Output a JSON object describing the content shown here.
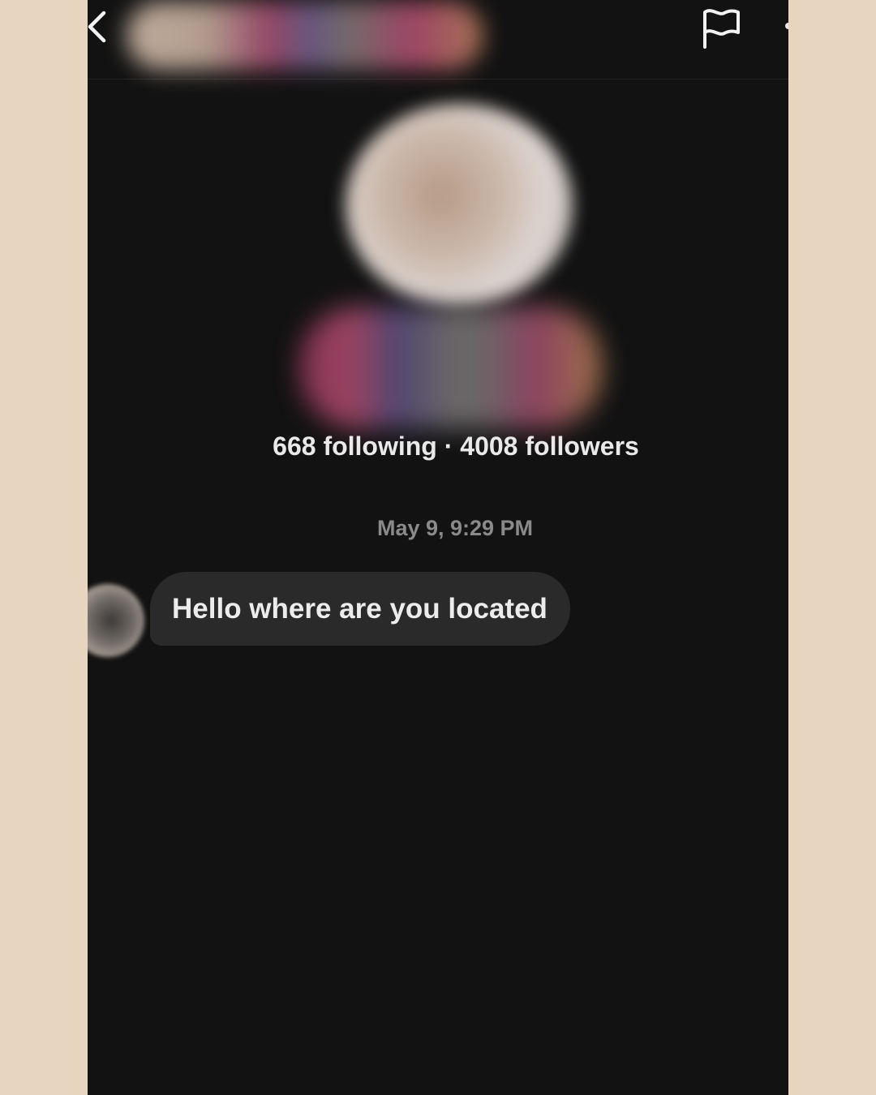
{
  "header": {
    "back_icon": "chevron-left-icon",
    "report_icon": "flag-icon",
    "more_icon": "more-dots-icon"
  },
  "profile": {
    "following_count": "668",
    "following_label": "following",
    "separator": "·",
    "followers_count": "4008",
    "followers_label": "followers",
    "stats_text": "668 following · 4008 followers"
  },
  "conversation": {
    "timestamp": "May 9, 9:29 PM",
    "messages": [
      {
        "from": "other",
        "text": "Hello where are you located"
      }
    ]
  },
  "colors": {
    "background": "#121212",
    "bubble": "#2a2a2a",
    "text": "#e9e9e9",
    "timestamp": "#8a8a8a",
    "frame": "#e7d5c0"
  }
}
